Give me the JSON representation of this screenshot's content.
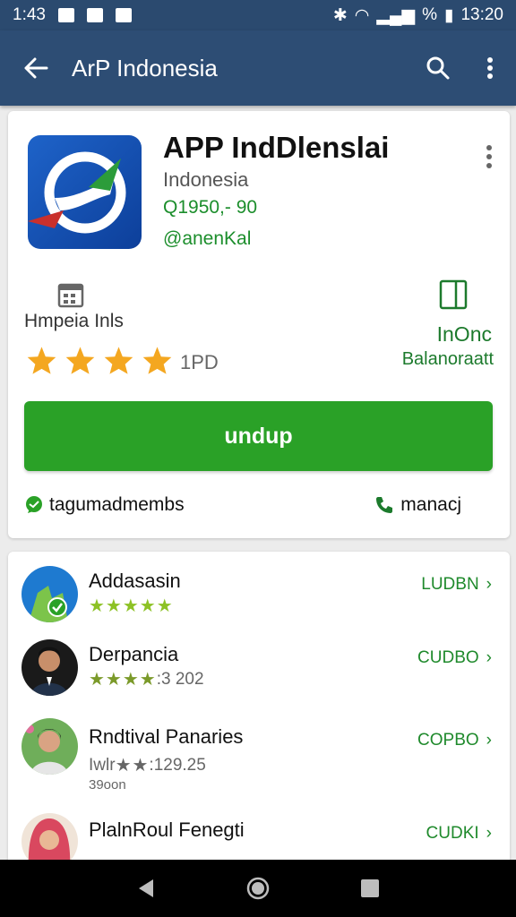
{
  "status_bar": {
    "time_left": "1:43",
    "time_right": "13:20",
    "battery_label": "%"
  },
  "app_bar": {
    "title": "ArP Indonesia"
  },
  "app": {
    "name": "APP IndDlenslai",
    "developer": "Indonesia",
    "price": "Q1950,- 90",
    "handle": "@anenKal",
    "category": "Hmpeia Inls",
    "rating_stars": 4,
    "rating_count": "1PD",
    "downloads_label": "InOnc",
    "downloads_sub": "Balanoraatt",
    "install_label": "undup",
    "share_label": "tagumadmembs",
    "manage_label": "manacj"
  },
  "colors": {
    "app_bar": "#2d4d74",
    "status_bar": "#2b4a6f",
    "install_button": "#2aa127",
    "accent_green": "#1c8e2c"
  },
  "list": [
    {
      "name": "Addasasin",
      "rating_text": "",
      "extra": "",
      "action": "LUDBN",
      "stars": "★★★★★"
    },
    {
      "name": "Derpancia",
      "rating_text": ":3 202",
      "extra": "",
      "action": "CUDBO",
      "stars": "★★★★"
    },
    {
      "name": "Rndtival Panaries",
      "rating_text": ":129.25",
      "extra": "39oon",
      "action": "COPBO",
      "stars": "★★",
      "prefix": "Iwlr"
    },
    {
      "name": "PlalnRoul Fenegti",
      "rating_text": "",
      "extra": "",
      "action": "CUDKI",
      "stars": ""
    }
  ]
}
